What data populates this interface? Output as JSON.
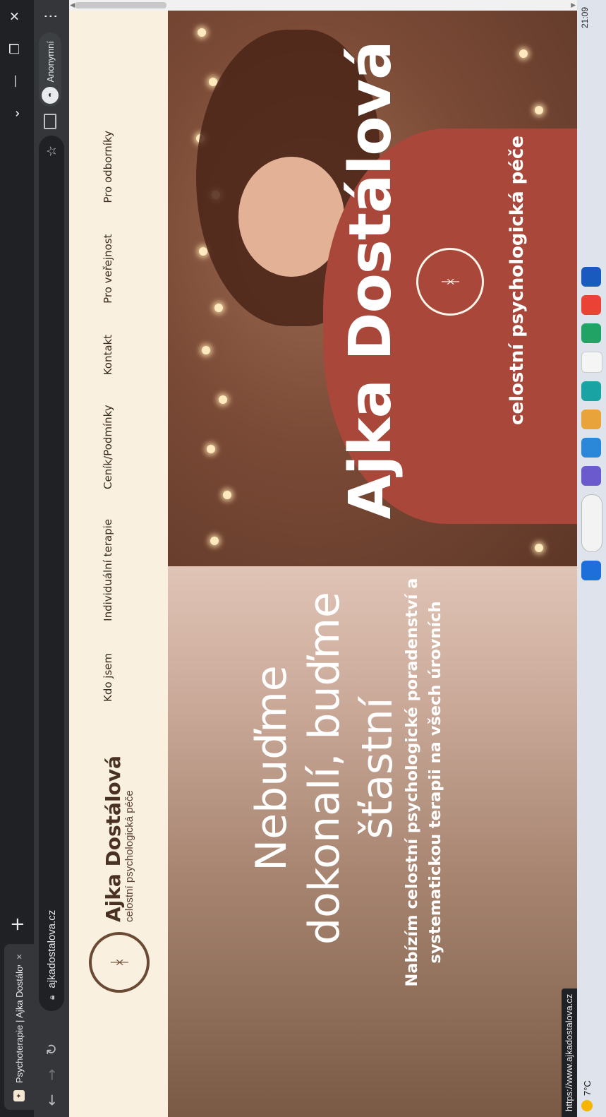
{
  "browser": {
    "tab_title": "Psychoterapie | Ajka Dostálová –",
    "tab_close": "×",
    "new_tab": "+",
    "url": "ajkadostalova.cz",
    "profile_label": "Anonymní",
    "status_url": "https://www.ajkadostalova.cz"
  },
  "site": {
    "brand_name": "Ajka Dostálová",
    "brand_tagline": "celostní psychologická péče",
    "menu": [
      "Kdo jsem",
      "Individuální terapie",
      "Ceník/Podmínky",
      "Kontakt",
      "Pro veřejnost",
      "Pro odborníky"
    ],
    "headline": "Nebuďme dokonalí, buďme šťastní",
    "subheadline": "Nabízím celostní psychologické poradenství a systematickou terapii na všech úrovních",
    "hero_name": "Ajka Dostálová",
    "hero_tagline": "celostní psychologická péče"
  },
  "taskbar": {
    "temperature": "7°C",
    "time": "21:09"
  },
  "colors": {
    "nav_bg": "#faf0e0",
    "brand_brown": "#4a3222",
    "hero_sweater": "#a9473a",
    "chrome_dark": "#202124"
  }
}
